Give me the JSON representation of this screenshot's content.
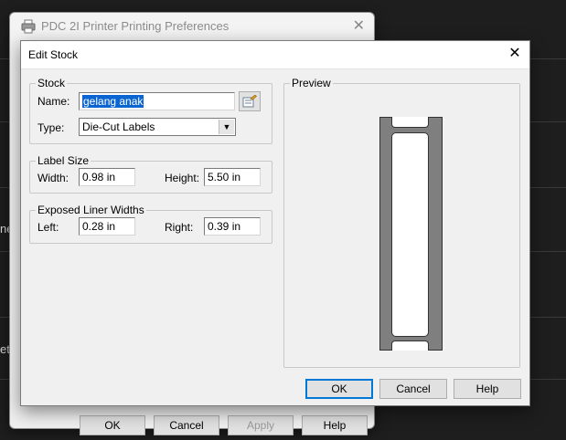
{
  "background": {
    "partial_texts": [
      "ner",
      "ett"
    ],
    "dialog_title": "PDC 2I Printer Printing Preferences",
    "buttons": {
      "ok": "OK",
      "cancel": "Cancel",
      "apply": "Apply",
      "help": "Help"
    }
  },
  "dialog": {
    "title": "Edit Stock",
    "stock": {
      "legend": "Stock",
      "name_label": "Name:",
      "name_value": "gelang anak",
      "type_label": "Type:",
      "type_value": "Die-Cut Labels"
    },
    "label_size": {
      "legend": "Label Size",
      "width_label": "Width:",
      "width_value": "0.98 in",
      "height_label": "Height:",
      "height_value": "5.50 in"
    },
    "liner": {
      "legend": "Exposed Liner Widths",
      "left_label": "Left:",
      "left_value": "0.28 in",
      "right_label": "Right:",
      "right_value": "0.39 in"
    },
    "preview": {
      "legend": "Preview"
    },
    "buttons": {
      "ok": "OK",
      "cancel": "Cancel",
      "help": "Help"
    }
  },
  "colors": {
    "liner": "#7f7f7f",
    "label": "#ffffff",
    "selection": "#0a64d2"
  }
}
